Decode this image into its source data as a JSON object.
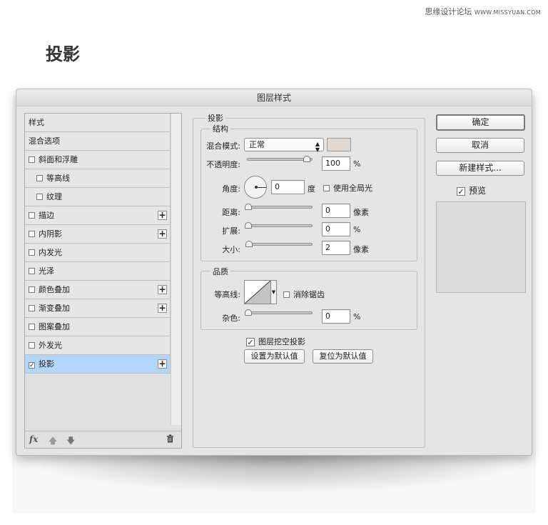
{
  "page": {
    "watermark_site": "思缘设计论坛",
    "watermark_url": "WWW.MISSYUAN.COM",
    "title": "投影"
  },
  "dialog": {
    "title": "图层样式"
  },
  "styles_panel": {
    "items": [
      {
        "label": "样式",
        "checkbox": false,
        "plus": false,
        "selected": false,
        "checked": false,
        "sub": false
      },
      {
        "label": "混合选项",
        "checkbox": false,
        "plus": false,
        "selected": false,
        "checked": false,
        "sub": false
      },
      {
        "label": "斜面和浮雕",
        "checkbox": true,
        "plus": false,
        "selected": false,
        "checked": false,
        "sub": false
      },
      {
        "label": "等高线",
        "checkbox": true,
        "plus": false,
        "selected": false,
        "checked": false,
        "sub": true
      },
      {
        "label": "纹理",
        "checkbox": true,
        "plus": false,
        "selected": false,
        "checked": false,
        "sub": true
      },
      {
        "label": "描边",
        "checkbox": true,
        "plus": true,
        "selected": false,
        "checked": false,
        "sub": false
      },
      {
        "label": "内阴影",
        "checkbox": true,
        "plus": true,
        "selected": false,
        "checked": false,
        "sub": false
      },
      {
        "label": "内发光",
        "checkbox": true,
        "plus": false,
        "selected": false,
        "checked": false,
        "sub": false
      },
      {
        "label": "光泽",
        "checkbox": true,
        "plus": false,
        "selected": false,
        "checked": false,
        "sub": false
      },
      {
        "label": "颜色叠加",
        "checkbox": true,
        "plus": true,
        "selected": false,
        "checked": false,
        "sub": false
      },
      {
        "label": "渐变叠加",
        "checkbox": true,
        "plus": true,
        "selected": false,
        "checked": false,
        "sub": false
      },
      {
        "label": "图案叠加",
        "checkbox": true,
        "plus": false,
        "selected": false,
        "checked": false,
        "sub": false
      },
      {
        "label": "外发光",
        "checkbox": true,
        "plus": false,
        "selected": false,
        "checked": false,
        "sub": false
      },
      {
        "label": "投影",
        "checkbox": true,
        "plus": true,
        "selected": true,
        "checked": true,
        "sub": false
      }
    ],
    "footer": {
      "fx_label": "fx",
      "up_icon": "arrow-up-icon",
      "down_icon": "arrow-down-icon",
      "trash_icon": "trash-icon"
    }
  },
  "drop_shadow": {
    "group_title": "投影",
    "structure_title": "结构",
    "blend_mode_label": "混合模式:",
    "blend_mode_value": "正常",
    "shadow_color": "#e3d8d0",
    "opacity_label": "不透明度:",
    "opacity_value": "100",
    "opacity_unit": "%",
    "opacity_level": 1.0,
    "angle_label": "角度:",
    "angle_value": "0",
    "angle_unit": "度",
    "global_light_label": "使用全局光",
    "global_light_checked": false,
    "distance_label": "距离:",
    "distance_value": "0",
    "distance_unit": "像素",
    "distance_level": 0,
    "spread_label": "扩展:",
    "spread_value": "0",
    "spread_unit": "%",
    "spread_level": 0,
    "size_label": "大小:",
    "size_value": "2",
    "size_unit": "像素",
    "size_level": 0.01,
    "quality_title": "品质",
    "contour_label": "等高线:",
    "anti_alias_label": "消除锯齿",
    "anti_alias_checked": false,
    "noise_label": "杂色:",
    "noise_value": "0",
    "noise_unit": "%",
    "noise_level": 0,
    "knockout_label": "图层挖空投影",
    "knockout_checked": true,
    "make_default_label": "设置为默认值",
    "reset_default_label": "复位为默认值"
  },
  "actions": {
    "ok_label": "确定",
    "cancel_label": "取消",
    "new_style_label": "新建样式...",
    "preview_label": "预览",
    "preview_checked": true
  },
  "colors": {
    "selected_row": "#b3d5f7",
    "dialog_bg": "#e5e5e5"
  }
}
